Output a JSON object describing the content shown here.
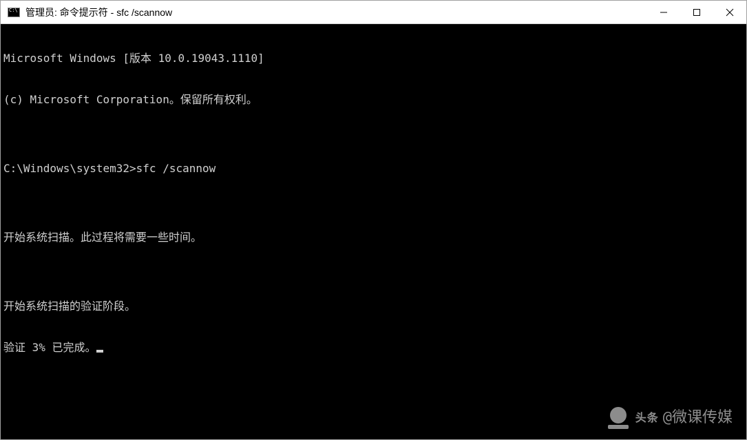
{
  "window": {
    "title": "管理员: 命令提示符 - sfc  /scannow"
  },
  "terminal": {
    "lines": [
      "Microsoft Windows [版本 10.0.19043.1110]",
      "(c) Microsoft Corporation。保留所有权利。",
      "",
      "C:\\Windows\\system32>sfc /scannow",
      "",
      "开始系统扫描。此过程将需要一些时间。",
      "",
      "开始系统扫描的验证阶段。",
      "验证 3% 已完成。"
    ]
  },
  "watermark": {
    "brand_top": "头条",
    "brand_bottom": "@微课传媒"
  },
  "controls": {
    "minimize": "minimize",
    "maximize": "maximize",
    "close": "close"
  }
}
